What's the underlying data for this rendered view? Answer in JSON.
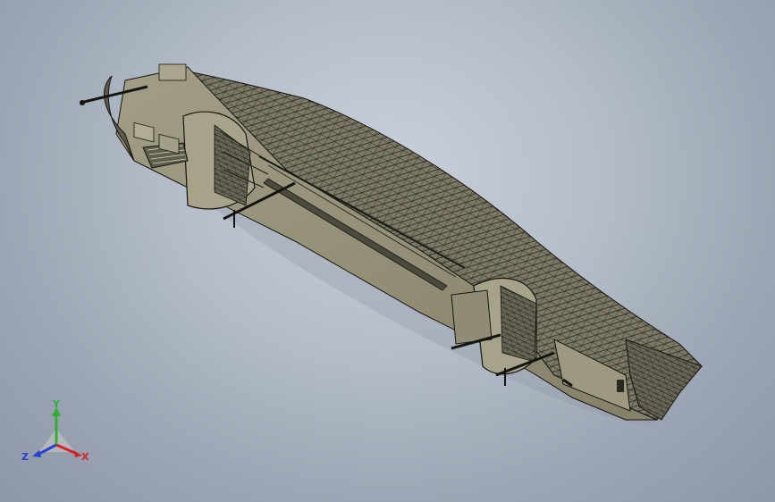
{
  "viewport": {
    "background_top": "#c9d0da",
    "background_bottom": "#8d97a6"
  },
  "model": {
    "hull_color": "#6f6c5a",
    "hull_light": "#9a9680",
    "deck_color": "#8a8670",
    "wire_color": "#1a1a14",
    "shadow_color": "#8e98a6"
  },
  "triad": {
    "y_label": "Y",
    "x_label": "X",
    "z_label": "Z",
    "y_color": "#2fb12f",
    "x_color": "#d42525",
    "z_color": "#2a3fd0"
  }
}
